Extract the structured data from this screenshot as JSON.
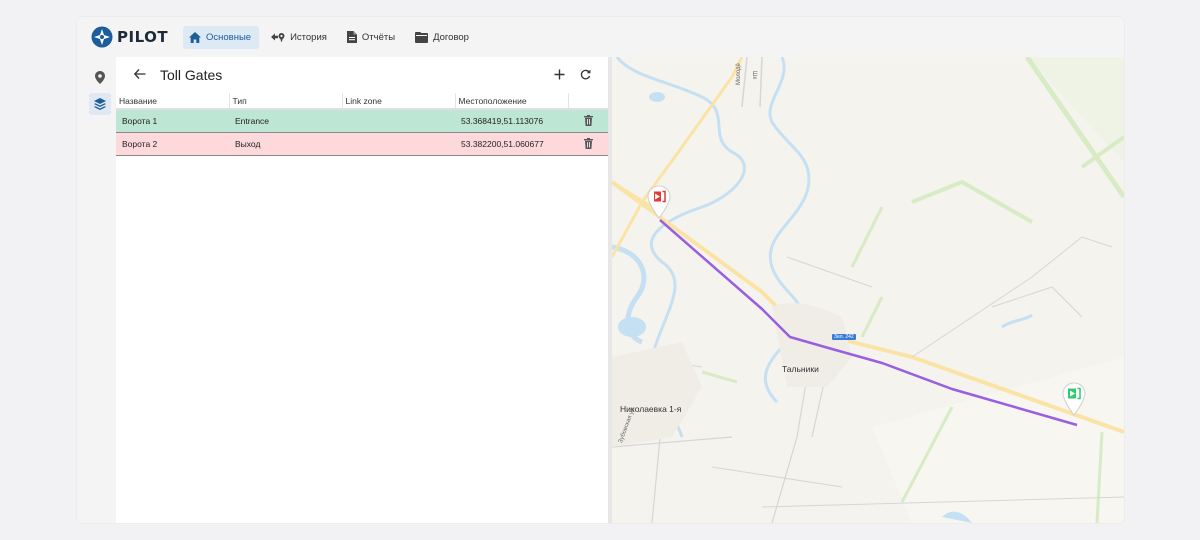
{
  "app": {
    "logo_text": "PILOT",
    "brand_color": "#1c2a3a",
    "accent_color": "#1b5e9b"
  },
  "nav": {
    "items": [
      {
        "label": "Основные",
        "icon": "home-icon",
        "active": true
      },
      {
        "label": "История",
        "icon": "history-icon",
        "active": false
      },
      {
        "label": "Отчёты",
        "icon": "report-icon",
        "active": false
      },
      {
        "label": "Договор",
        "icon": "contract-icon",
        "active": false
      }
    ]
  },
  "rail": {
    "items": [
      {
        "icon": "location-pin-icon"
      },
      {
        "icon": "layers-icon",
        "active": true
      }
    ]
  },
  "panel": {
    "title": "Toll Gates",
    "columns": [
      "Название",
      "Тип",
      "Link zone",
      "Местоположение",
      ""
    ],
    "rows": [
      {
        "name": "Ворота 1",
        "type": "Entrance",
        "link_zone": "",
        "location": "53.368419,51.113076",
        "status_color": "#bde6d5"
      },
      {
        "name": "Ворота 2",
        "type": "Выход",
        "link_zone": "",
        "location": "53.382200,51.060677",
        "status_color": "#fdd9dc"
      }
    ]
  },
  "map": {
    "labels": {
      "village_1": "Тальники",
      "village_2": "Николаевка 1-я",
      "street_1": "Зубовская ул.",
      "street_2": "Молодё",
      "street_3": "Шк",
      "road_badge": "Зел. 242"
    },
    "route_color": "#9a5ee0",
    "entry_marker_color": "#2ecc71",
    "exit_marker_color": "#e03a3a"
  }
}
